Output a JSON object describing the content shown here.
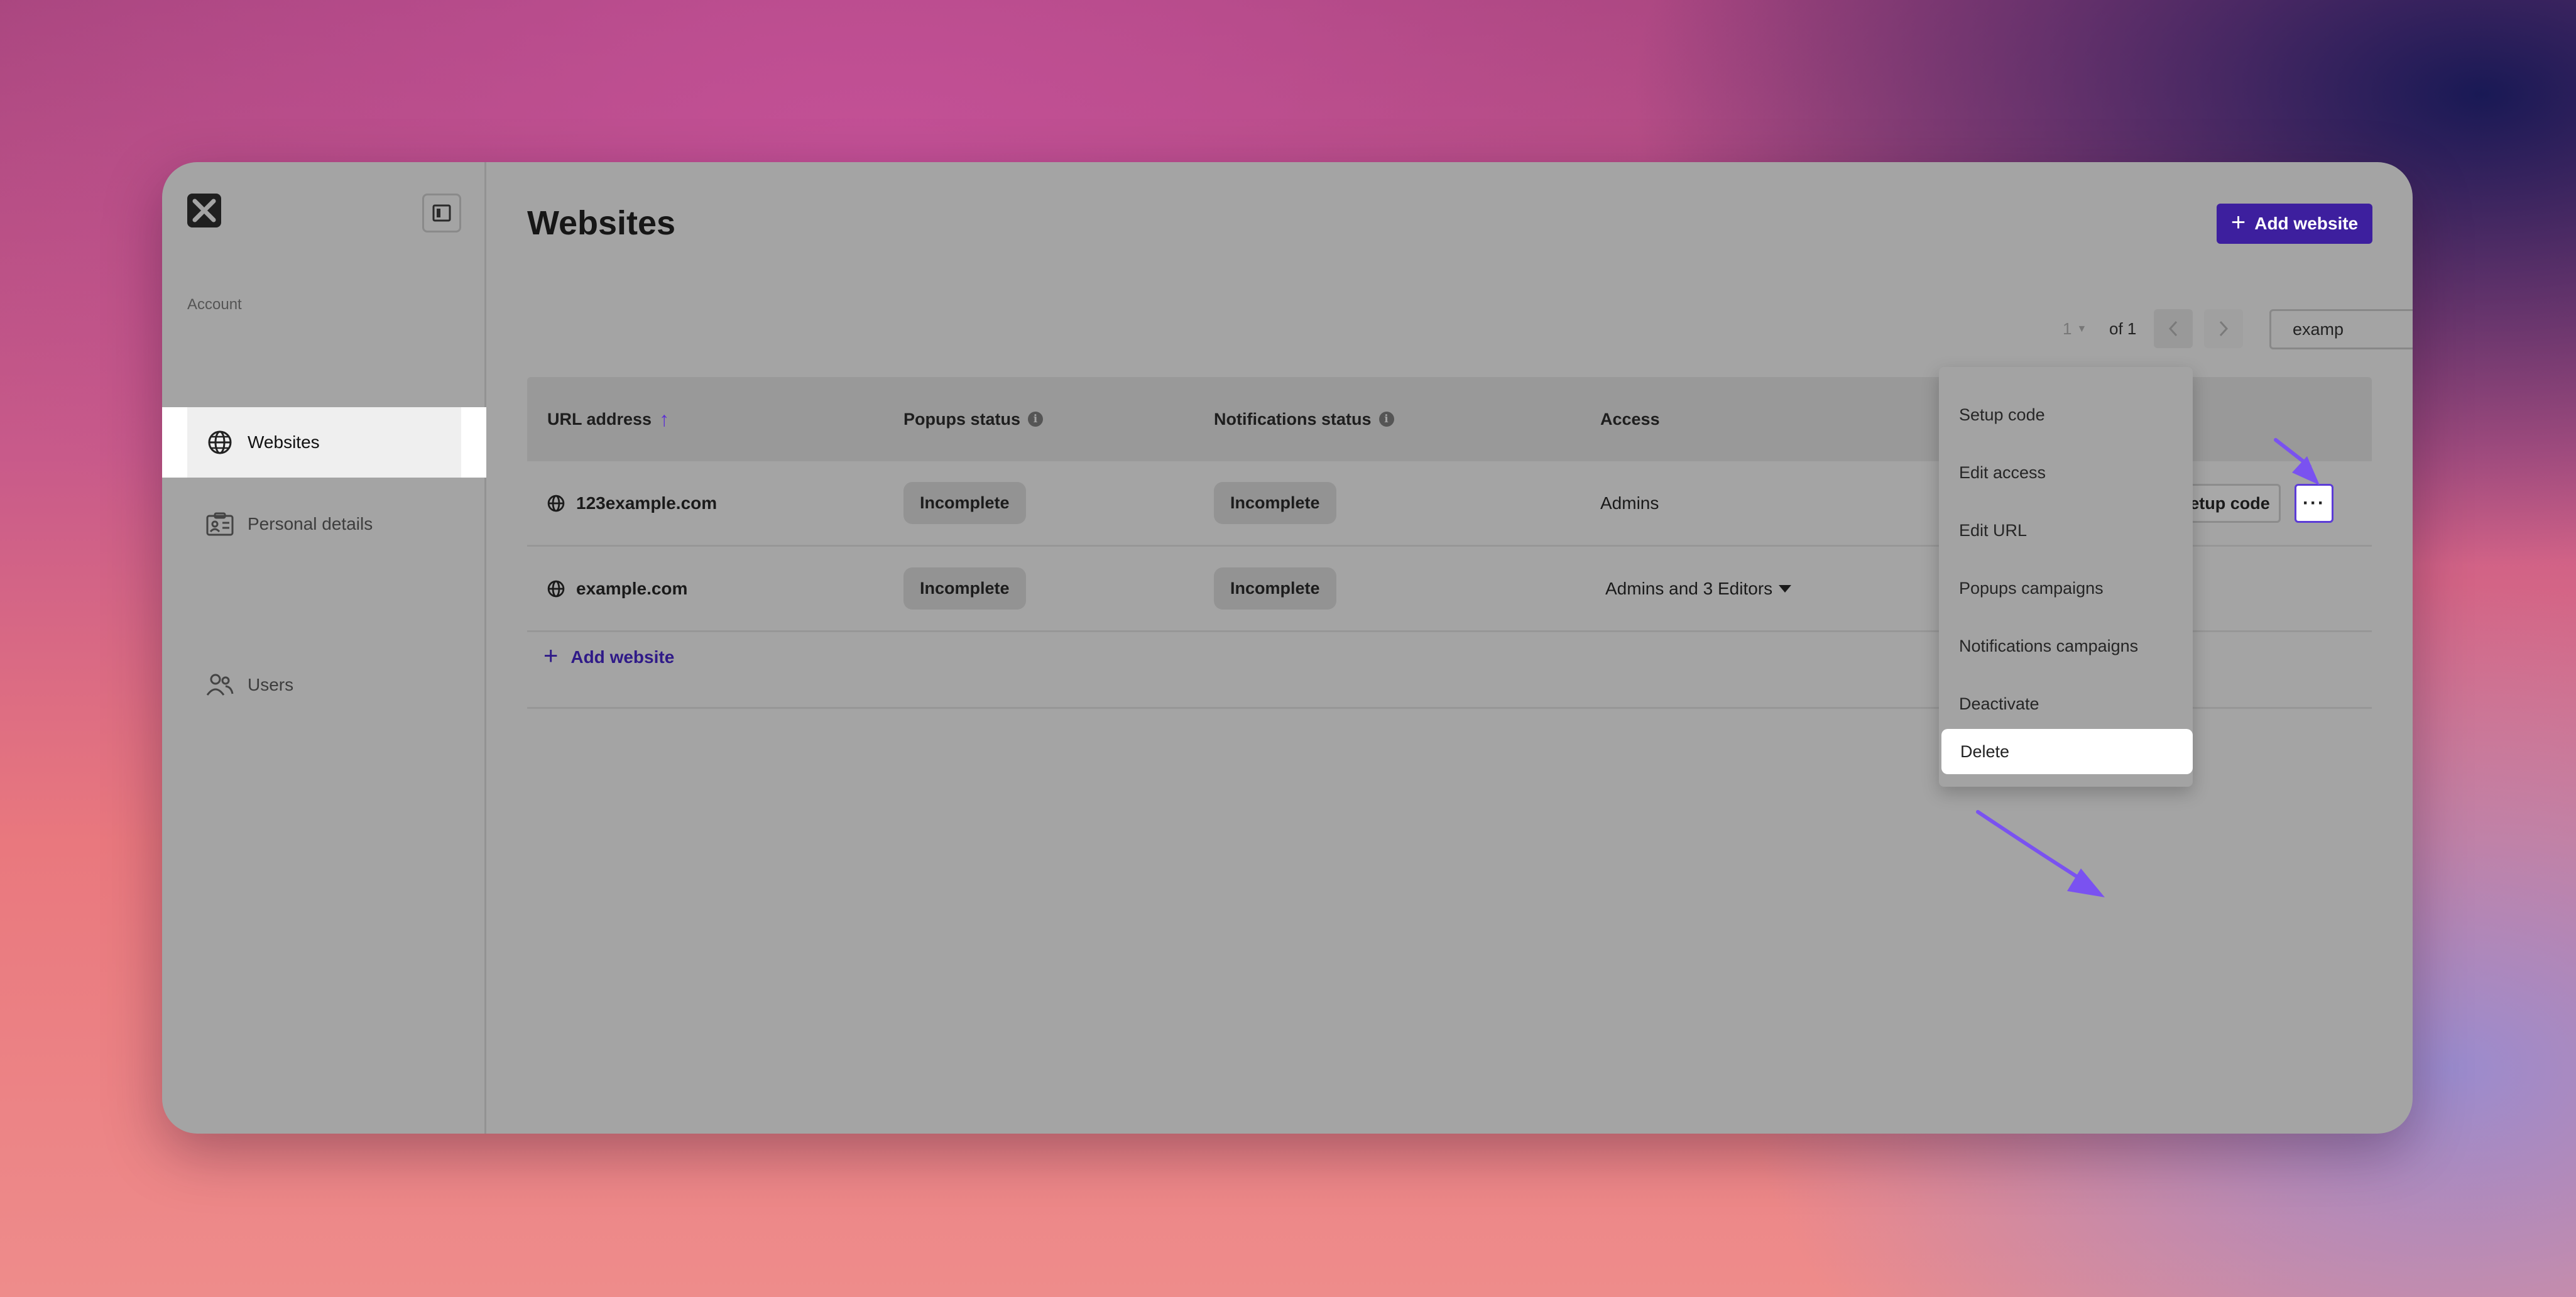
{
  "colors": {
    "accent": "#3d1f9e",
    "annotation_arrow": "#7a52f0",
    "overlay_gray": "#a4a4a4"
  },
  "sidebar": {
    "logo": "brand-logo",
    "collapse_icon": "sidebar-collapse-icon",
    "section_label": "Account",
    "items": [
      {
        "label": "Personal details",
        "icon": "id-card-icon",
        "active": false
      },
      {
        "label": "Websites",
        "icon": "globe-icon",
        "active": true
      },
      {
        "label": "Users",
        "icon": "users-icon",
        "active": false
      }
    ]
  },
  "header": {
    "title": "Websites",
    "add_button_label": "Add website"
  },
  "pagination": {
    "current_page": "1",
    "of_label": "of 1"
  },
  "search": {
    "value": "examp"
  },
  "table": {
    "columns": {
      "url": "URL address",
      "popups": "Popups status",
      "notifications": "Notifications status",
      "access": "Access"
    },
    "rows": [
      {
        "url": "123example.com",
        "popups": "Incomplete",
        "notifications": "Incomplete",
        "access": "Admins",
        "setup_label": "Setup code",
        "more_label": "···"
      },
      {
        "url": "example.com",
        "popups": "Incomplete",
        "notifications": "Incomplete",
        "access": "Admins and 3 Editors"
      }
    ],
    "add_link_label": "Add website"
  },
  "menu": {
    "items": [
      "Setup code",
      "Edit access",
      "Edit URL",
      "Popups campaigns",
      "Notifications campaigns",
      "Deactivate",
      "Delete"
    ],
    "highlighted_index": 6
  }
}
